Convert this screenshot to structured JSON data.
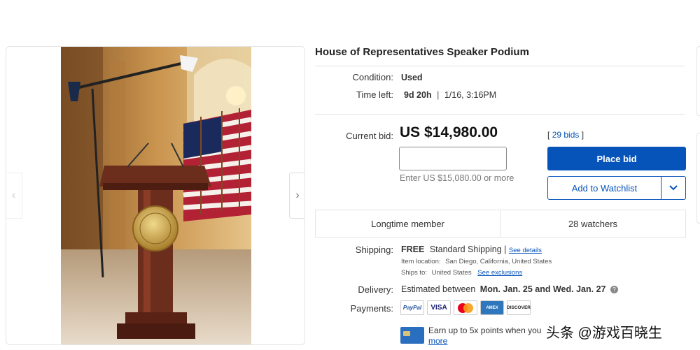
{
  "listing": {
    "title": "House of Representatives Speaker Podium",
    "condition_label": "Condition:",
    "condition_value": "Used",
    "time_left_label": "Time left:",
    "time_left_value": "9d 20h",
    "time_left_sep": "|",
    "end_date": "1/16, 3:16PM"
  },
  "bid": {
    "current_bid_label": "Current bid:",
    "current_bid_value": "US $14,980.00",
    "input_value": "",
    "hint": "Enter US $15,080.00 or more",
    "bids_open": "[",
    "bids_link": "29 bids",
    "bids_close": "]",
    "place_bid_label": "Place bid",
    "watchlist_label": "Add to Watchlist",
    "watchlist_dropdown_icon": "chevron-down-icon"
  },
  "stats": {
    "seller": "Longtime member",
    "watchers": "28 watchers"
  },
  "shipping": {
    "label": "Shipping:",
    "free": "FREE",
    "method": "Standard Shipping",
    "sep": "|",
    "details_link": "See details",
    "item_location_label": "Item location:",
    "item_location_value": "San Diego, California, United States",
    "ships_to_label": "Ships to:",
    "ships_to_value": "United States",
    "exclusions_link": "See exclusions"
  },
  "delivery": {
    "label": "Delivery:",
    "prefix": "Estimated between",
    "range": "Mon. Jan. 25 and Wed. Jan. 27",
    "info_icon": "info-icon"
  },
  "payments": {
    "label": "Payments:",
    "methods": [
      "PayPal",
      "VISA",
      "Mastercard",
      "AMEX",
      "DISCOVER"
    ]
  },
  "promo": {
    "text": "Earn up to 5x points when you",
    "more_link": "more"
  },
  "watermark": "头条 @游戏百晓生",
  "colors": {
    "link": "#0654ba",
    "primary_button": "#0654ba"
  }
}
